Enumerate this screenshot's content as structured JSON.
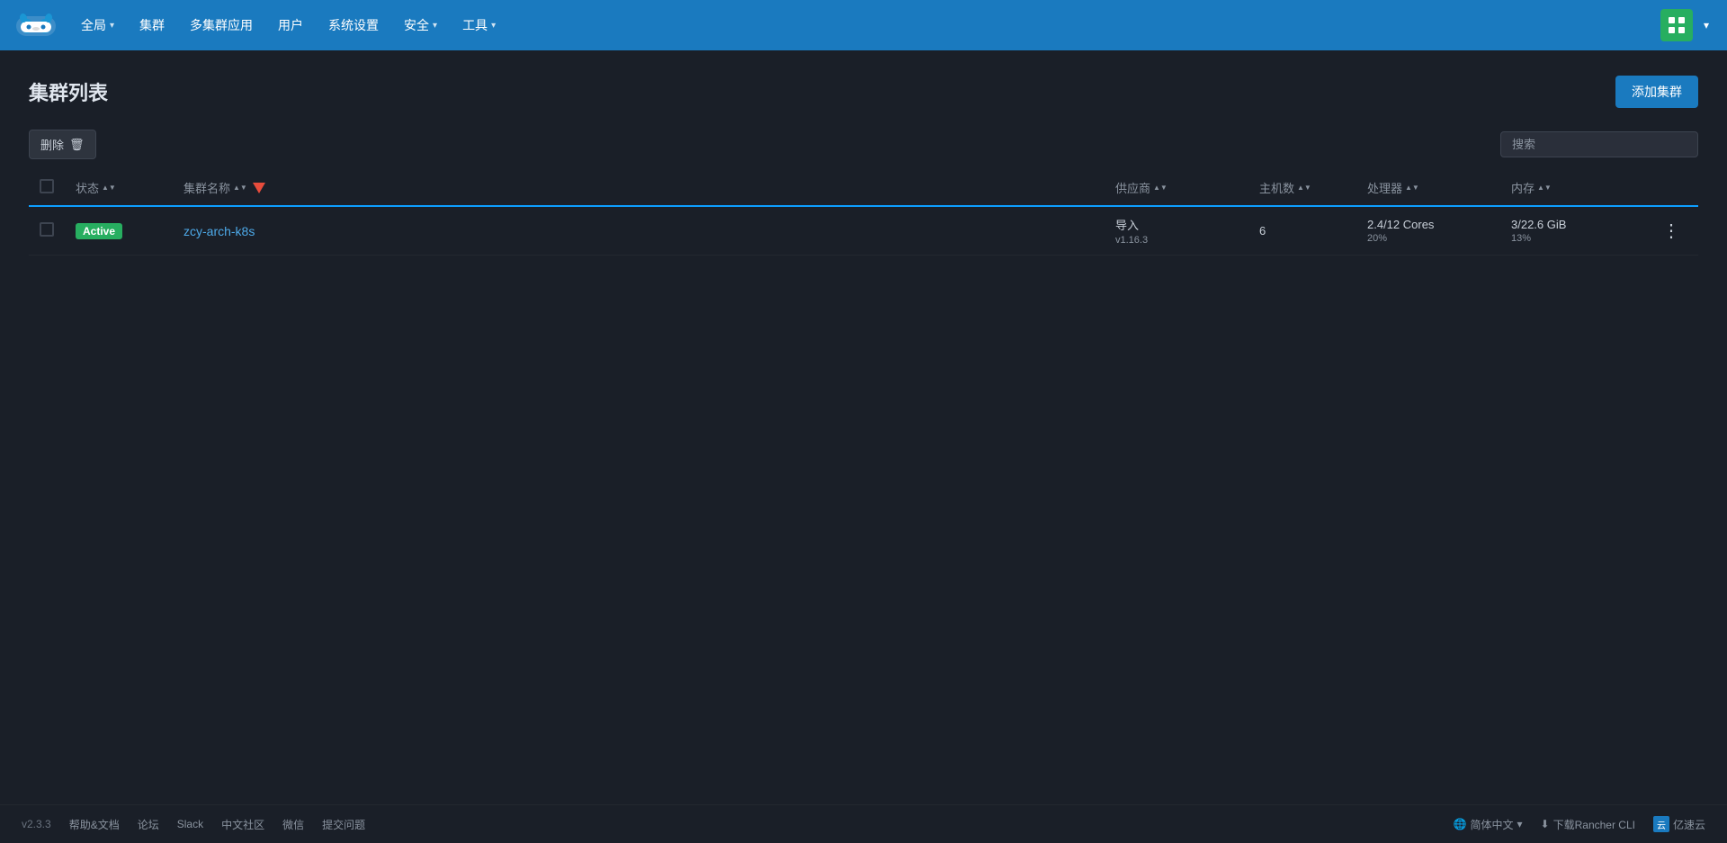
{
  "navbar": {
    "logo_alt": "Rancher Logo",
    "items": [
      {
        "label": "全局",
        "has_dropdown": true
      },
      {
        "label": "集群",
        "has_dropdown": false
      },
      {
        "label": "多集群应用",
        "has_dropdown": false
      },
      {
        "label": "用户",
        "has_dropdown": false
      },
      {
        "label": "系统设置",
        "has_dropdown": false
      },
      {
        "label": "安全",
        "has_dropdown": true
      },
      {
        "label": "工具",
        "has_dropdown": true
      }
    ]
  },
  "page": {
    "title": "集群列表",
    "add_button_label": "添加集群"
  },
  "toolbar": {
    "delete_label": "删除",
    "search_placeholder": "搜索"
  },
  "table": {
    "columns": [
      {
        "key": "checkbox",
        "label": ""
      },
      {
        "key": "status",
        "label": "状态",
        "sortable": true
      },
      {
        "key": "name",
        "label": "集群名称",
        "sortable": true,
        "active_sort": true
      },
      {
        "key": "provider",
        "label": "供应商",
        "sortable": true
      },
      {
        "key": "hosts",
        "label": "主机数",
        "sortable": true
      },
      {
        "key": "cpu",
        "label": "处理器",
        "sortable": true
      },
      {
        "key": "memory",
        "label": "内存",
        "sortable": true
      },
      {
        "key": "actions",
        "label": ""
      }
    ],
    "rows": [
      {
        "id": 1,
        "status": "Active",
        "name": "zcy-arch-k8s",
        "provider": "导入",
        "provider_version": "v1.16.3",
        "hosts": "6",
        "cpu": "2.4/12 Cores",
        "cpu_pct": "20%",
        "memory": "3/22.6 GiB",
        "memory_pct": "13%"
      }
    ]
  },
  "footer": {
    "version": "v2.3.3",
    "links": [
      {
        "label": "帮助&文档"
      },
      {
        "label": "论坛"
      },
      {
        "label": "Slack"
      },
      {
        "label": "中文社区"
      },
      {
        "label": "微信"
      },
      {
        "label": "提交问题"
      }
    ],
    "lang_label": "简体中文",
    "download_label": "下载Rancher CLI",
    "yiyun_label": "亿速云"
  }
}
